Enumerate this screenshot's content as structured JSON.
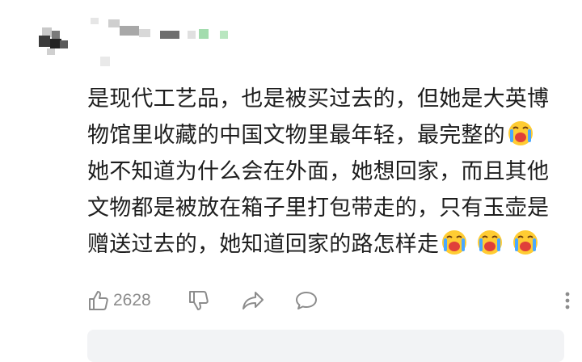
{
  "comment": {
    "lines": [
      "是现代工艺品，也是被买过去的，但她是大英博",
      "物馆里收藏的中国文物里最年轻，最完整的",
      "她不知道为什么会在外面，她想回家，而且其他",
      "文物都是被放在箱子里打包带走的，只有玉壶是",
      "赠送过去的，她知道回家的路怎样走"
    ],
    "emoji_name": "loudly-crying-face"
  },
  "actions": {
    "like_count": "2628",
    "like_icon": "thumbs-up-icon",
    "dislike_icon": "thumbs-down-icon",
    "share_icon": "share-arrow-icon",
    "comment_icon": "comment-bubble-icon",
    "more_icon": "more-vertical-icon"
  },
  "colors": {
    "text": "#1e1e1e",
    "icon": "#8c8c8c",
    "reply_box": "#f2f3f5",
    "emoji_face": "#ffcc33",
    "emoji_tear": "#4aa8ff",
    "emoji_mouth": "#e0403a"
  }
}
